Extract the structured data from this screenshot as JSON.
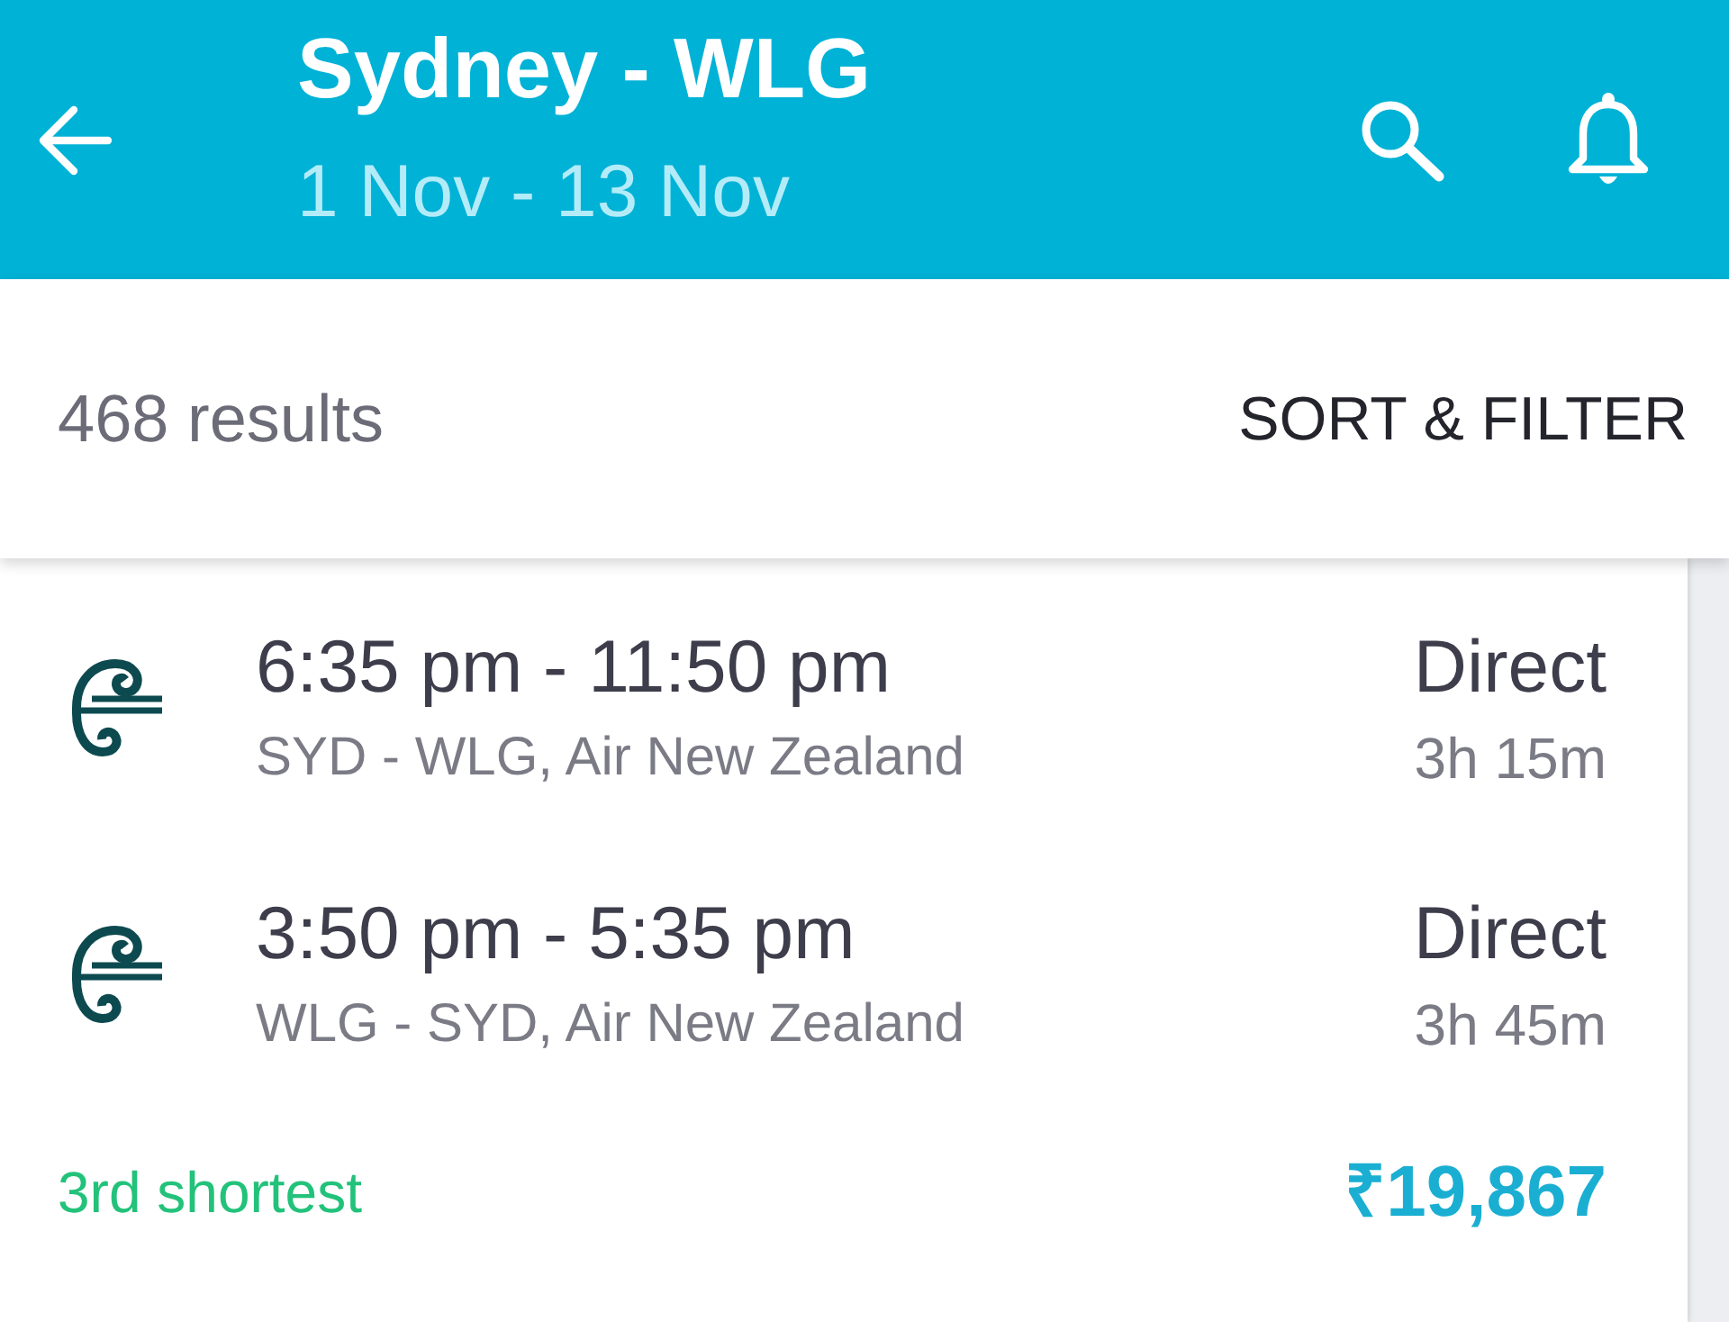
{
  "app_bar": {
    "title": "Sydney - WLG",
    "subtitle": "1 Nov - 13 Nov"
  },
  "results_bar": {
    "count": "468 results",
    "sort_filter": "SORT & FILTER"
  },
  "itinerary": {
    "legs": [
      {
        "times": "6:35 pm - 11:50 pm",
        "route": "SYD - WLG, Air New Zealand",
        "stops": "Direct",
        "duration": "3h 15m"
      },
      {
        "times": "3:50 pm - 5:35 pm",
        "route": "WLG - SYD, Air New Zealand",
        "stops": "Direct",
        "duration": "3h 45m"
      }
    ],
    "tag": "3rd shortest",
    "price": "₹19,867"
  }
}
